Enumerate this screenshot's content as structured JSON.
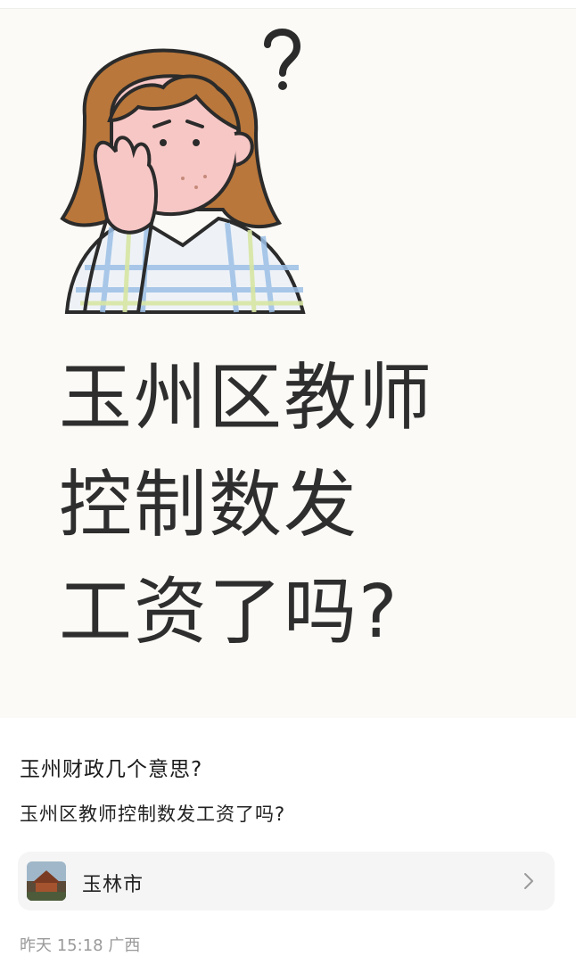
{
  "image_text": {
    "line1": "玉州区教师",
    "line2": "控制数发",
    "line3": "工资了吗?"
  },
  "post": {
    "title": "玉州财政几个意思?",
    "body": "玉州区教师控制数发工资了吗?",
    "location": "玉林市",
    "time": "昨天 15:18",
    "region": "广西"
  },
  "icons": {
    "chevron": "chevron-right-icon",
    "question": "question-mark-icon"
  },
  "colors": {
    "image_bg": "#fbfaf6",
    "text_dark": "#2e2e2e",
    "meta_gray": "#9a9a9a",
    "card_bg": "#f5f5f5"
  }
}
